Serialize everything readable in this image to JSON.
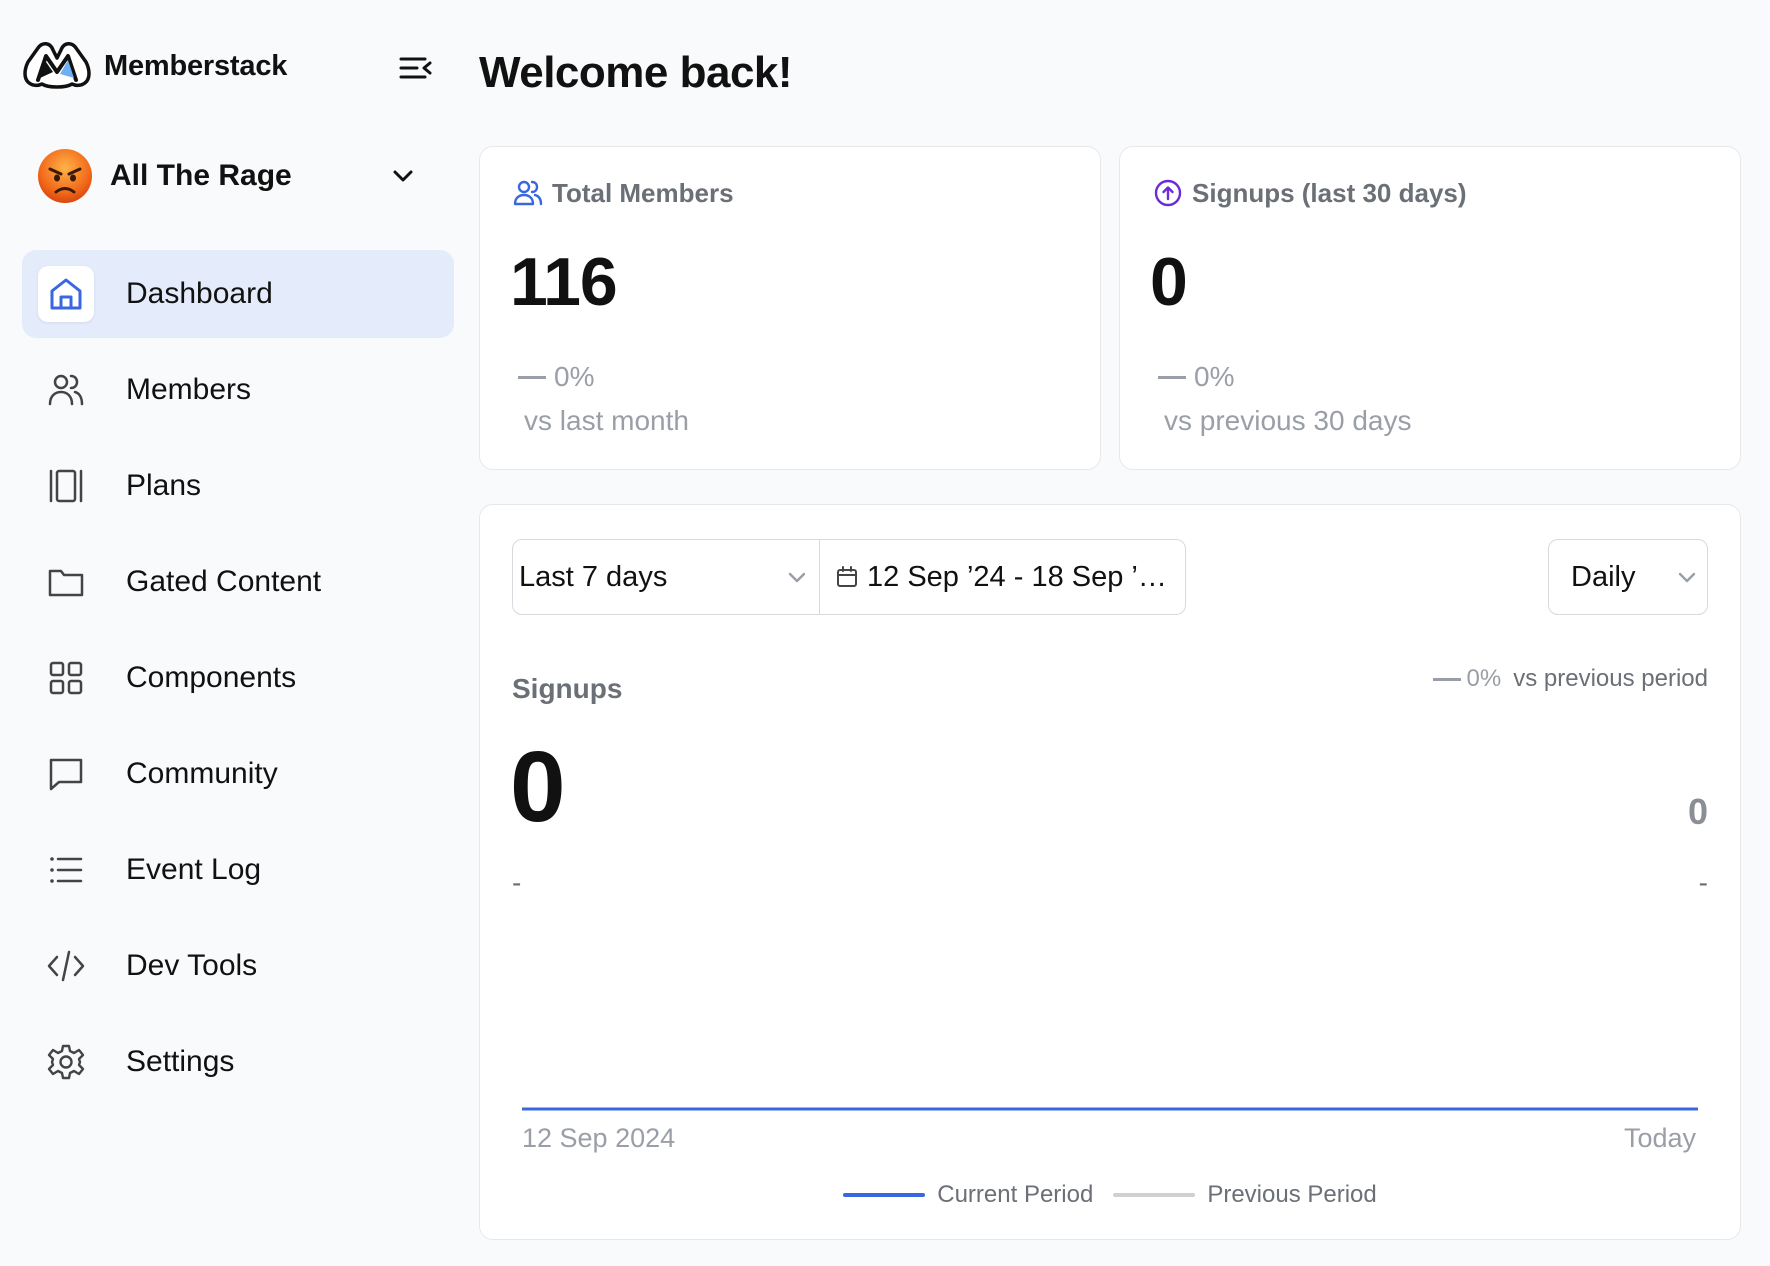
{
  "app": {
    "brand_name": "Memberstack"
  },
  "workspace": {
    "name": "All The Rage"
  },
  "sidebar": {
    "items": [
      {
        "label": "Dashboard",
        "icon": "home-icon",
        "active": true
      },
      {
        "label": "Members",
        "icon": "users-icon",
        "active": false
      },
      {
        "label": "Plans",
        "icon": "plans-icon",
        "active": false
      },
      {
        "label": "Gated Content",
        "icon": "folder-icon",
        "active": false
      },
      {
        "label": "Components",
        "icon": "grid-icon",
        "active": false
      },
      {
        "label": "Community",
        "icon": "chat-icon",
        "active": false
      },
      {
        "label": "Event Log",
        "icon": "list-icon",
        "active": false
      },
      {
        "label": "Dev Tools",
        "icon": "code-icon",
        "active": false
      },
      {
        "label": "Settings",
        "icon": "gear-icon",
        "active": false
      }
    ]
  },
  "page": {
    "title": "Welcome back!"
  },
  "stats": {
    "total_members": {
      "title": "Total Members",
      "value": "116",
      "change": "0%",
      "compare": "vs last month"
    },
    "signups": {
      "title": "Signups (last 30 days)",
      "value": "0",
      "change": "0%",
      "compare": "vs previous 30 days"
    }
  },
  "filters": {
    "range": "Last 7 days",
    "date_range": "12 Sep ’24 - 18 Sep ’…",
    "interval": "Daily"
  },
  "chart_panel": {
    "title": "Signups",
    "value": "0",
    "change": "0%",
    "compare": "vs previous period",
    "right_value": "0",
    "sub_left": "-",
    "sub_right": "-"
  },
  "chart_data": {
    "type": "area",
    "x_start_label": "12 Sep 2024",
    "x_end_label": "Today",
    "series": [
      {
        "name": "Current Period",
        "values": [
          0,
          0,
          0,
          0,
          0,
          0,
          0
        ]
      },
      {
        "name": "Previous Period",
        "values": []
      }
    ],
    "grid": false,
    "legend": "bottom-center"
  },
  "colors": {
    "accent": "#3a67e0",
    "active_nav_bg": "#e4ecfc",
    "area_fill": "#eef0fd",
    "previous_period": "#d0d0d0",
    "signup_icon": "#6b2bd9"
  }
}
